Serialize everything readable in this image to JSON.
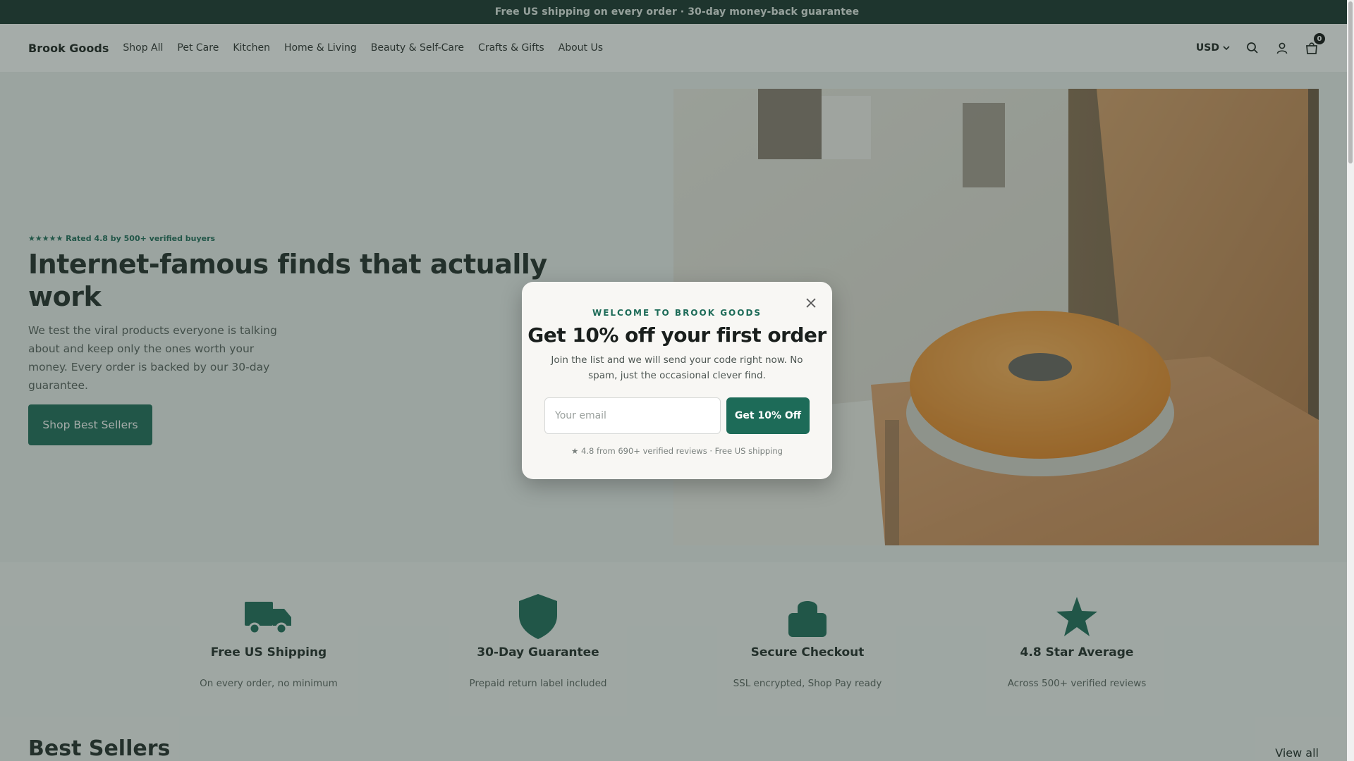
{
  "announcement": "Free US shipping on every order · 30-day money-back guarantee",
  "header": {
    "brand": "Brook Goods",
    "nav": [
      "Shop All",
      "Pet Care",
      "Kitchen",
      "Home & Living",
      "Beauty & Self-Care",
      "Crafts & Gifts",
      "About Us"
    ],
    "currency": "USD",
    "cart_count": "0",
    "icons": [
      "search-icon",
      "account-icon",
      "cart-icon"
    ]
  },
  "hero": {
    "rating": "★★★★★ Rated 4.8 by 500+ verified buyers",
    "title": "Internet-famous finds that actually work",
    "subtitle": "We test the viral products everyone is talking about and keep only the ones worth your money. Every order is backed by our 30-day guarantee.",
    "cta": "Shop Best Sellers"
  },
  "features": [
    {
      "icon": "truck-icon",
      "title": "Free US Shipping",
      "subtitle": "On every order, no minimum"
    },
    {
      "icon": "shield-icon",
      "title": "30-Day Guarantee",
      "subtitle": "Prepaid return label included"
    },
    {
      "icon": "lock-icon",
      "title": "Secure Checkout",
      "subtitle": "SSL encrypted, Shop Pay ready"
    },
    {
      "icon": "star-icon",
      "title": "4.8 Star Average",
      "subtitle": "Across 500+ verified reviews"
    }
  ],
  "best_sellers": {
    "title": "Best Sellers",
    "view_all": "View all"
  },
  "modal": {
    "kicker": "WELCOME TO BROOK GOODS",
    "title": "Get 10% off your first order",
    "subtitle": "Join the list and we will send your code right now. No spam, just the occasional clever find.",
    "email_placeholder": "Your email",
    "button": "Get 10% Off",
    "footer": "★ 4.8 from 690+ verified reviews · Free US shipping"
  },
  "colors": {
    "accent": "#1d6b58",
    "announcement_bg": "#17322b",
    "overlay": "rgba(40,58,50,0.42)"
  }
}
